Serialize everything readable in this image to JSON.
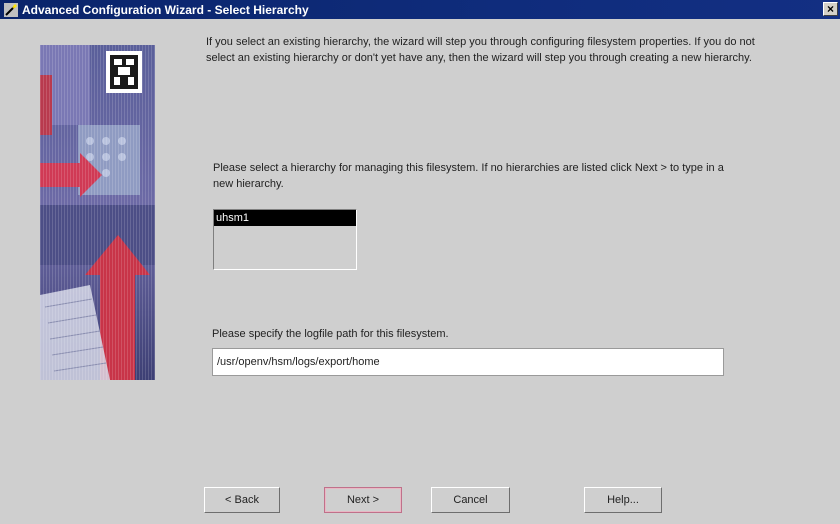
{
  "window": {
    "title": "Advanced Configuration Wizard - Select Hierarchy",
    "close_label": "×"
  },
  "content": {
    "intro": "If you select an existing hierarchy, the wizard will step you through configuring filesystem properties. If you do not select an existing hierarchy or don't yet have any, then the wizard will step you through creating a new hierarchy.",
    "hierarchy_prompt": "Please select a hierarchy for managing this filesystem. If no hierarchies are listed click Next > to type in a new hierarchy.",
    "hierarchies": [
      "uhsm1"
    ],
    "selected_hierarchy": "uhsm1",
    "logfile_prompt": "Please specify the logfile path for this filesystem.",
    "logfile_path": "/usr/openv/hsm/logs/export/home"
  },
  "buttons": {
    "back": "< Back",
    "next": "Next >",
    "cancel": "Cancel",
    "help": "Help..."
  },
  "colors": {
    "titlebar": "#0a246a",
    "dialog_bg": "#cfcfcf",
    "selection": "#000000",
    "default_button_border": "#c0708a"
  },
  "icons": {
    "title": "wizard-wand-icon",
    "close": "close-icon",
    "banner": "wizard-banner-graphic"
  }
}
